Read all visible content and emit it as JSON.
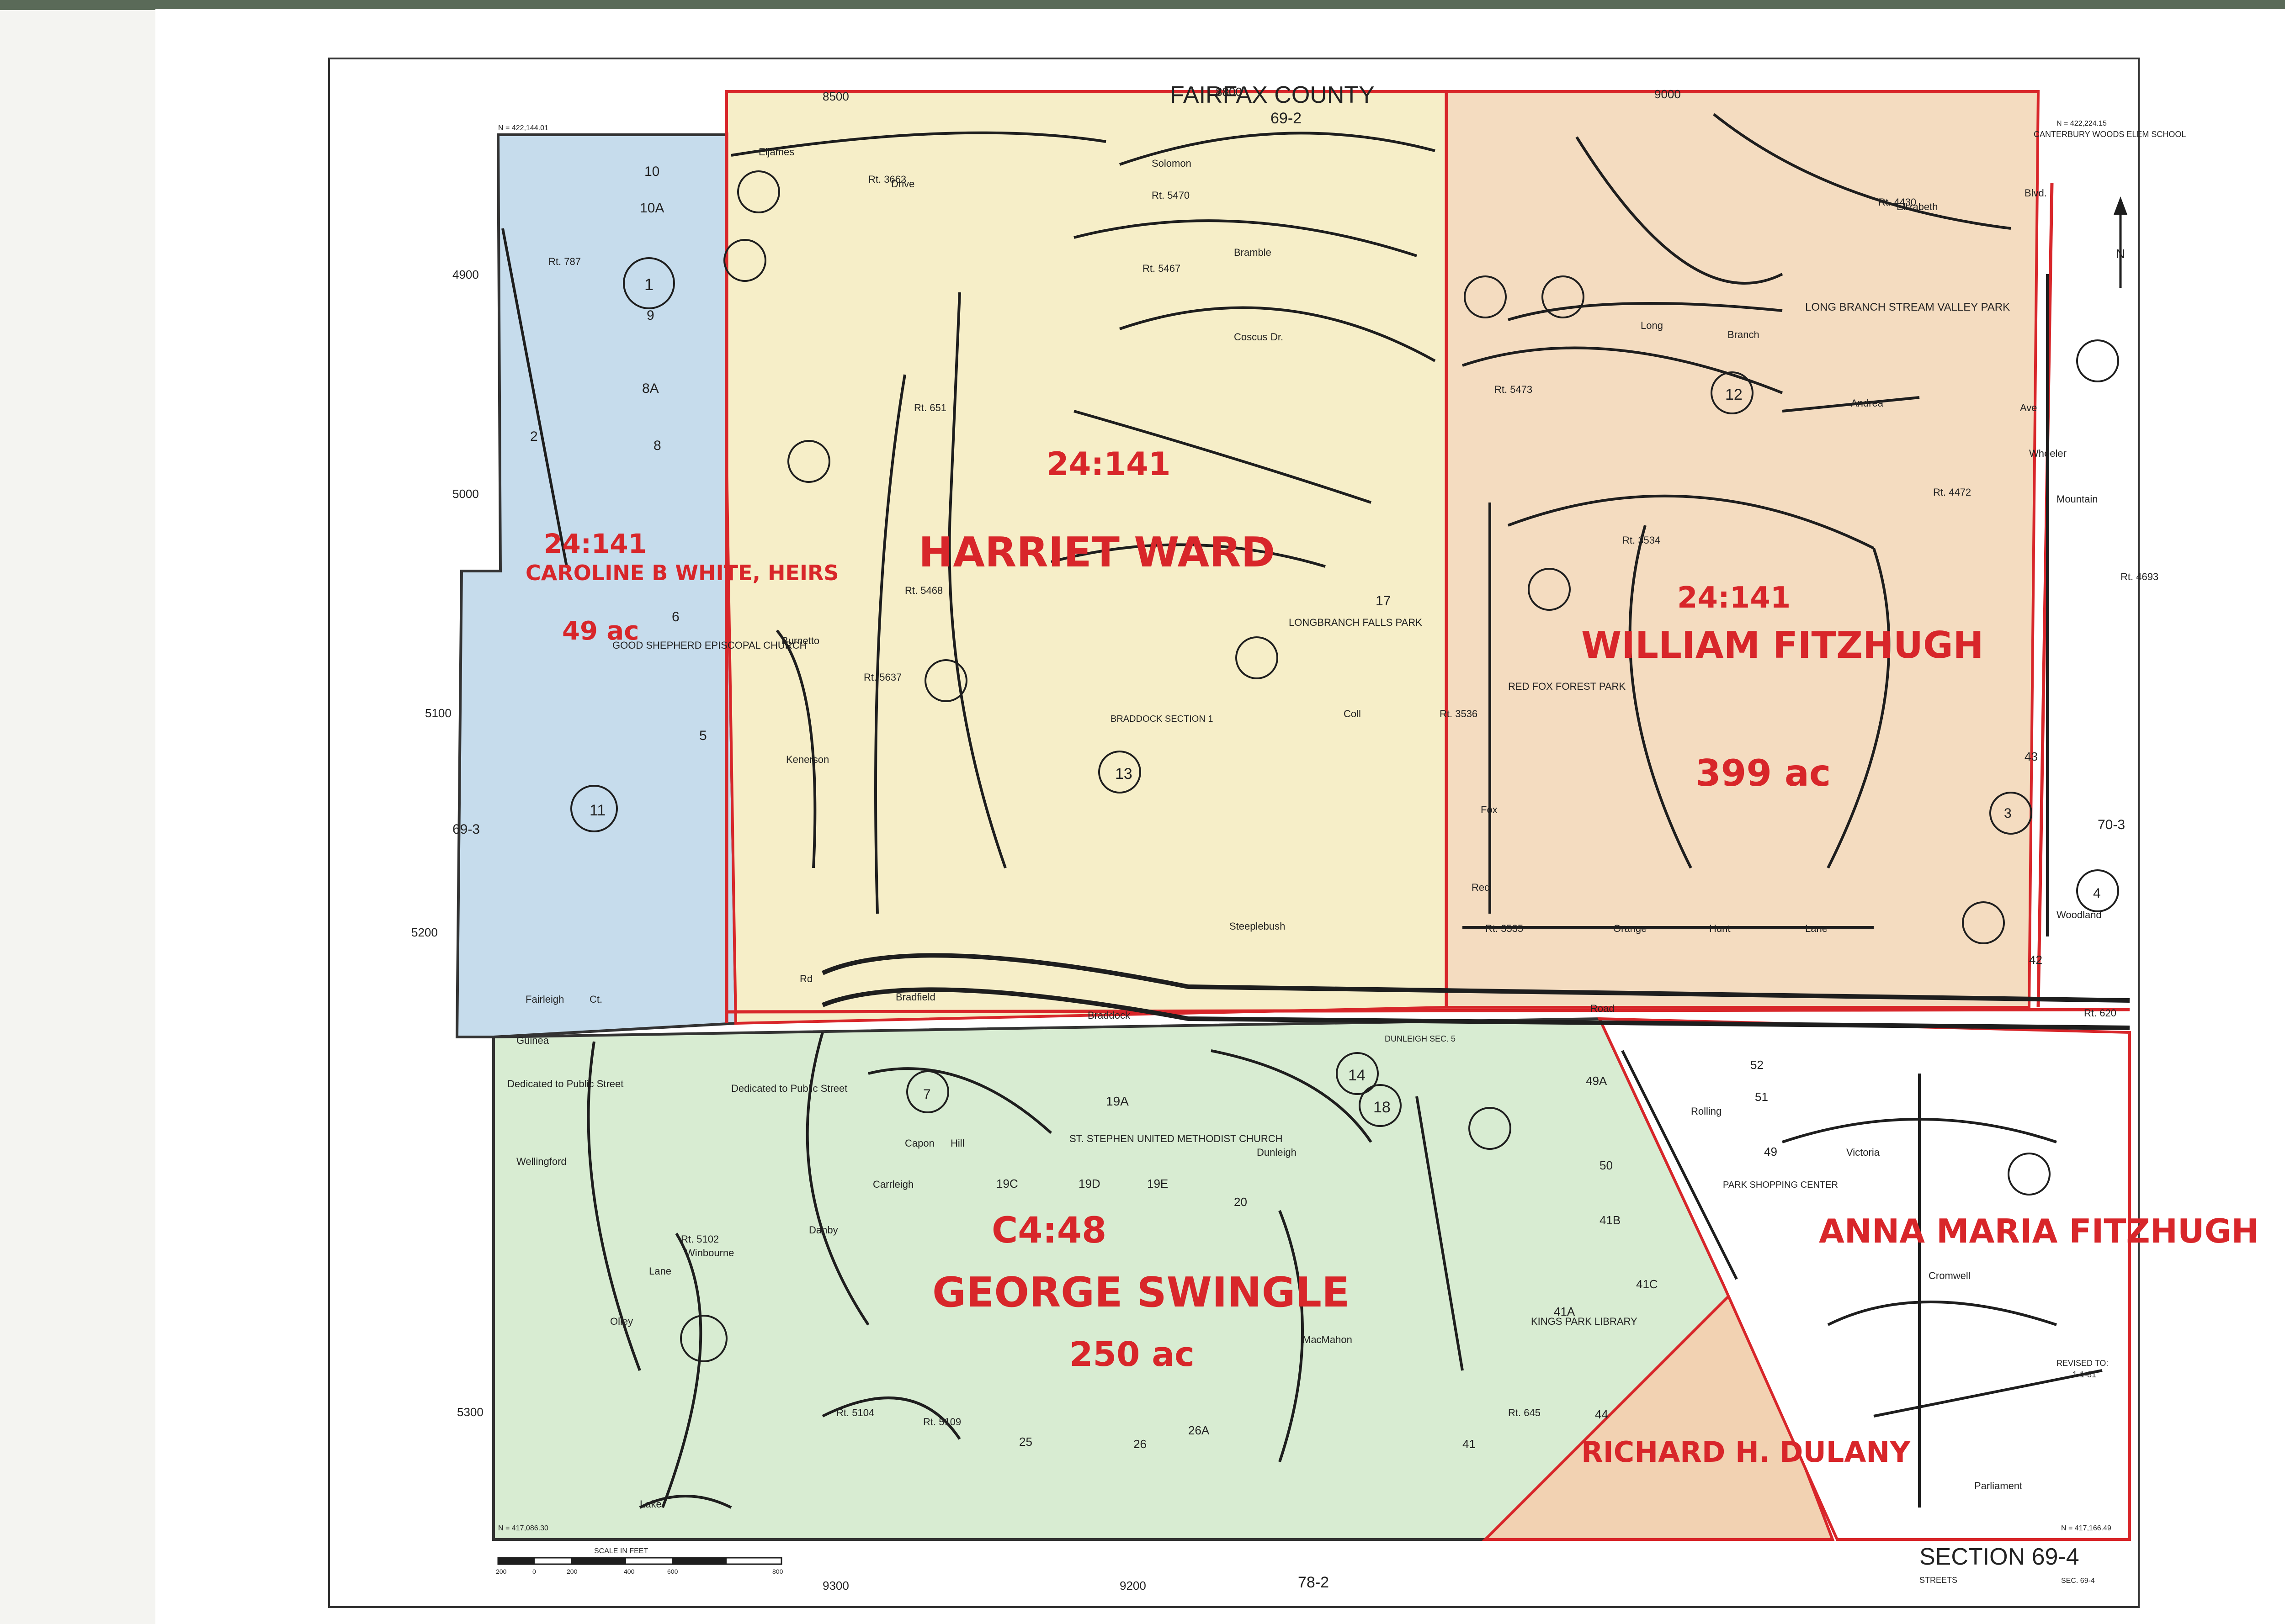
{
  "header": {
    "county": "FAIRFAX    COUNTY",
    "top_sheet": "69-2",
    "bottom_sheet": "78-2",
    "left_sheet": "69-3",
    "right_sheet": "70-3"
  },
  "footer": {
    "section_title": "SECTION  69-4",
    "streets": "STREETS",
    "sec_ref": "SEC. 69-4",
    "scale_label": "SCALE  IN  FEET",
    "scale_ticks": [
      "200",
      "0",
      "200",
      "400",
      "600",
      "800"
    ],
    "revised": "REVISED TO:",
    "revised_date": "1-1-81"
  },
  "corner_coords": {
    "top_left_n": "N = 422,144.01",
    "top_right_n": "N = 422,224.15",
    "bottom_left_n": "N = 417,086.30",
    "bottom_right_n": "N = 417,166.49"
  },
  "grid_labels": [
    "4900",
    "5000",
    "5100",
    "5200",
    "5300",
    "8500",
    "8800",
    "9000",
    "9200",
    "9300"
  ],
  "parcels": [
    {
      "id": "24:141",
      "owner": "CAROLINE B WHITE, HEIRS",
      "area": "49 ac",
      "color": "#c6dcec"
    },
    {
      "id": "24:141",
      "owner": "HARRIET WARD",
      "area": "",
      "color": "#f6eec8"
    },
    {
      "id": "24:141",
      "owner": "WILLIAM FITZHUGH",
      "area": "399 ac",
      "color": "#f4dcc0"
    },
    {
      "id": "C4:48",
      "owner": "GEORGE SWINGLE",
      "area": "250 ac",
      "color": "#d8ecd2"
    },
    {
      "id": "",
      "owner": "RICHARD H. DULANY",
      "area": "",
      "color": "#f2d2b2"
    },
    {
      "id": "",
      "owner": "ANNA MARIA FITZHUGH",
      "area": "",
      "color": "#ffffff"
    }
  ],
  "landmarks": [
    "GOOD SHEPHERD EPISCOPAL CHURCH",
    "LONGBRANCH FALLS PARK",
    "LONG BRANCH STREAM VALLEY PARK",
    "RED FOX FOREST PARK",
    "ST. STEPHEN UNITED METHODIST CHURCH",
    "KINGS PARK LIBRARY",
    "PARK SHOPPING CENTER",
    "CANTERBURY WOODS ELEM SCHOOL",
    "Dedicated to Public Street",
    "Dedicated to Public Street",
    "BRADDOCK SECTION 1",
    "DUNLEIGH SEC. 5"
  ],
  "streets": [
    "Braddock",
    "Road",
    "Guinea",
    "Rd",
    "Orange",
    "Hunt",
    "Lane",
    "Long",
    "Branch",
    "Andrea",
    "Ave",
    "Elizabeth",
    "Blvd.",
    "Solomon",
    "Bramble",
    "Coscus",
    "Dr.",
    "Eljames",
    "Drive",
    "Burnetto",
    "Kenerson",
    "Fairleigh",
    "Ct.",
    "Steeplebush",
    "Wellingford",
    "Olley",
    "Lane",
    "Winbourne",
    "Danby",
    "Dunleigh",
    "MacMahon",
    "Rolling",
    "Lake",
    "Cromwell",
    "Parliament",
    "Victoria",
    "Coll",
    "Red",
    "Fox",
    "Mountain",
    "Wheeler",
    "Carrleigh",
    "Capon",
    "Hill",
    "Woodland",
    "Bradfield",
    "Rt. 3663",
    "Rt. 5470",
    "Rt. 5467",
    "Rt. 5473",
    "Rt. 5637",
    "Rt. 5468",
    "Rt. 3534",
    "Rt. 3535",
    "Rt. 3536",
    "Rt. 4472",
    "Rt. 4430",
    "Rt. 4693",
    "Rt. 5102",
    "Rt. 5104",
    "Rt. 5109",
    "Rt. 620",
    "Rt. 645",
    "Rt. 787",
    "Rt. 651"
  ],
  "lot_numbers": [
    "10",
    "10A",
    "1",
    "9",
    "8A",
    "8",
    "2",
    "6",
    "5",
    "11",
    "13",
    "12",
    "14",
    "18",
    "17",
    "19A",
    "19C",
    "19D",
    "19E",
    "20",
    "25",
    "26",
    "26A",
    "41",
    "41A",
    "41B",
    "41C",
    "42",
    "43",
    "44",
    "49",
    "49A",
    "50",
    "51",
    "52",
    "3",
    "4",
    "7"
  ],
  "colors": {
    "red_ink": "#d8262a",
    "line_ink": "#1e1e1e",
    "white_parcel": "#c6dcec",
    "ward_parcel": "#f6eec8",
    "fitzhugh_parcel": "#f4dcc0",
    "swingle_parcel": "#d8ecd2",
    "dulany_parcel": "#f2d2b2"
  }
}
